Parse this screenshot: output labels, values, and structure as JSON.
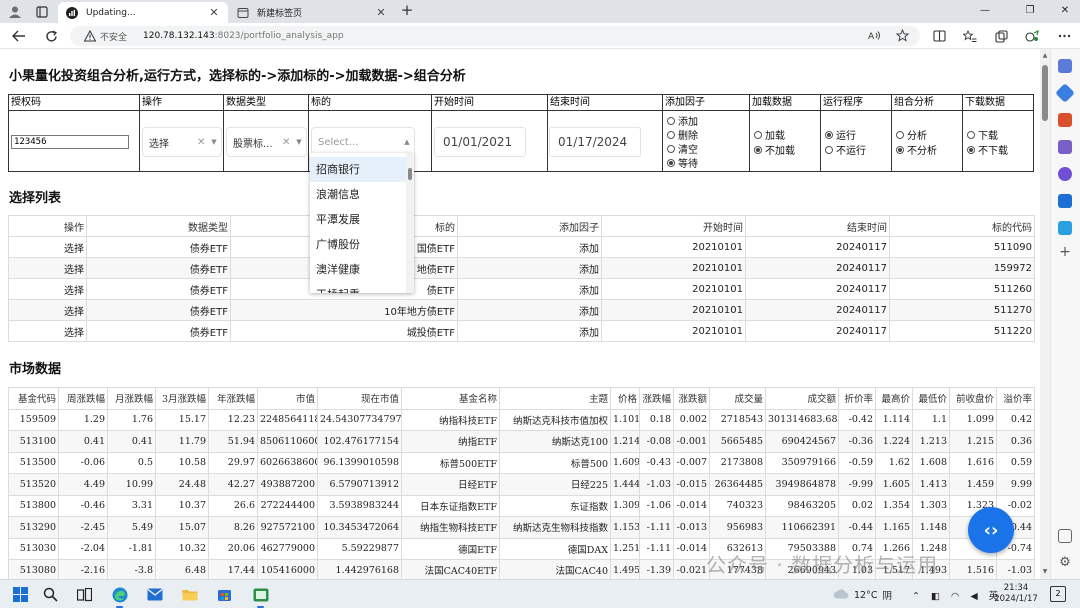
{
  "browser": {
    "tabs": [
      {
        "title": "Updating..."
      },
      {
        "title": "新建标签页"
      }
    ],
    "address": {
      "security_label": "不安全",
      "host": "120.78.132.143",
      "path": ":8023/portfolio_analysis_app"
    }
  },
  "page": {
    "title": "小果量化投资组合分析,运行方式，选择标的->添加标的->加载数据->组合分析",
    "controls": {
      "headers": [
        "授权码",
        "操作",
        "数据类型",
        "标的",
        "开始时间",
        "结束时间",
        "添加因子",
        "加载数据",
        "运行程序",
        "组合分析",
        "下载数据"
      ],
      "auth_code": "123456",
      "operation_value": "选择",
      "datatype_value": "股票标...",
      "target_placeholder": "Select...",
      "start_date": "01/01/2021",
      "end_date": "01/17/2024",
      "factor_options": [
        {
          "label": "添加",
          "selected": false
        },
        {
          "label": "删除",
          "selected": false
        },
        {
          "label": "清空",
          "selected": false
        },
        {
          "label": "等待",
          "selected": true
        }
      ],
      "load_options": [
        {
          "label": "加载",
          "selected": false
        },
        {
          "label": "不加载",
          "selected": true
        }
      ],
      "run_options": [
        {
          "label": "运行",
          "selected": true
        },
        {
          "label": "不运行",
          "selected": false
        }
      ],
      "analysis_options": [
        {
          "label": "分析",
          "selected": false
        },
        {
          "label": "不分析",
          "selected": true
        }
      ],
      "download_options": [
        {
          "label": "下载",
          "selected": false
        },
        {
          "label": "不下载",
          "selected": true
        }
      ]
    },
    "dropdown_options": [
      "招商银行",
      "浪潮信息",
      "平潭发展",
      "广博股份",
      "澳洋健康",
      "天桥起重"
    ],
    "selection_list": {
      "heading": "选择列表",
      "columns": [
        "操作",
        "数据类型",
        "标的",
        "添加因子",
        "开始时间",
        "结束时间",
        "标的代码"
      ],
      "rows": [
        [
          "选择",
          "债券ETF",
          "国债ETF",
          "添加",
          "20210101",
          "20240117",
          "511090"
        ],
        [
          "选择",
          "债券ETF",
          "地债ETF",
          "添加",
          "20210101",
          "20240117",
          "159972"
        ],
        [
          "选择",
          "债券ETF",
          "债ETF",
          "添加",
          "20210101",
          "20240117",
          "511260"
        ],
        [
          "选择",
          "债券ETF",
          "10年地方债ETF",
          "添加",
          "20210101",
          "20240117",
          "511270"
        ],
        [
          "选择",
          "债券ETF",
          "城投债ETF",
          "添加",
          "20210101",
          "20240117",
          "511220"
        ]
      ]
    },
    "market_data": {
      "heading": "市场数据",
      "columns": [
        "基金代码",
        "周涨跌幅",
        "月涨跌幅",
        "3月涨跌幅",
        "年涨跌幅",
        "市值",
        "现在市值",
        "基金名称",
        "主题",
        "价格",
        "涨跌幅",
        "涨跌额",
        "成交量",
        "成交额",
        "折价率",
        "最高价",
        "最低价",
        "前收盘价",
        "溢价率"
      ],
      "rows": [
        [
          "159509",
          "1.29",
          "1.76",
          "15.17",
          "12.23",
          "2248564118",
          "24.54307734797",
          "纳指科技ETF",
          "纳斯达克科技市值加权",
          "1.101",
          "0.18",
          "0.002",
          "2718543",
          "301314683.682",
          "-0.42",
          "1.114",
          "1.1",
          "1.099",
          "0.42"
        ],
        [
          "513100",
          "0.41",
          "0.41",
          "11.79",
          "51.94",
          "8506110600",
          "102.476177154",
          "纳指ETF",
          "纳斯达克100",
          "1.214",
          "-0.08",
          "-0.001",
          "5665485",
          "690424567",
          "-0.36",
          "1.224",
          "1.213",
          "1.215",
          "0.36"
        ],
        [
          "513500",
          "-0.06",
          "0.5",
          "10.58",
          "29.97",
          "6026638600",
          "96.1399010598",
          "标普500ETF",
          "标普500",
          "1.609",
          "-0.43",
          "-0.007",
          "2173808",
          "350979166",
          "-0.59",
          "1.62",
          "1.608",
          "1.616",
          "0.59"
        ],
        [
          "513520",
          "4.49",
          "10.99",
          "24.48",
          "42.27",
          "493887200",
          "6.5790713912",
          "日经ETF",
          "日经225",
          "1.444",
          "-1.03",
          "-0.015",
          "26364485",
          "3949864878",
          "-9.99",
          "1.605",
          "1.413",
          "1.459",
          "9.99"
        ],
        [
          "513800",
          "-0.46",
          "3.31",
          "10.37",
          "26.6",
          "272244400",
          "3.5938983244",
          "日本东证指数ETF",
          "东证指数",
          "1.309",
          "-1.06",
          "-0.014",
          "740323",
          "98463205",
          "0.02",
          "1.354",
          "1.303",
          "1.323",
          "-0.02"
        ],
        [
          "513290",
          "-2.45",
          "5.49",
          "15.07",
          "8.26",
          "927572100",
          "10.3453472064",
          "纳指生物科技ETF",
          "纳斯达克生物科技指数",
          "1.153",
          "-1.11",
          "-0.013",
          "956983",
          "110662391",
          "-0.44",
          "1.165",
          "1.148",
          "",
          "0.44"
        ],
        [
          "513030",
          "-2.04",
          "-1.81",
          "10.32",
          "20.06",
          "462779000",
          "5.59229877",
          "德国ETF",
          "德国DAX",
          "1.251",
          "-1.11",
          "-0.014",
          "632613",
          "79503388",
          "0.74",
          "1.266",
          "1.248",
          "",
          "-0.74"
        ],
        [
          "513080",
          "-2.16",
          "-3.8",
          "6.48",
          "17.44",
          "105416000",
          "1.442976168",
          "法国CAC40ETF",
          "法国CAC40",
          "1.495",
          "-1.39",
          "-0.021",
          "177438",
          "26690943",
          "1.03",
          "1.517",
          "1.493",
          "1.516",
          "-1.03"
        ]
      ]
    },
    "watermark": "公众号 · 数据分析与运用"
  },
  "taskbar": {
    "weather_temp": "12°C",
    "weather_desc": "阴",
    "ime": "英",
    "time": "21:34",
    "date": "2024/1/17",
    "notification_count": "2"
  }
}
